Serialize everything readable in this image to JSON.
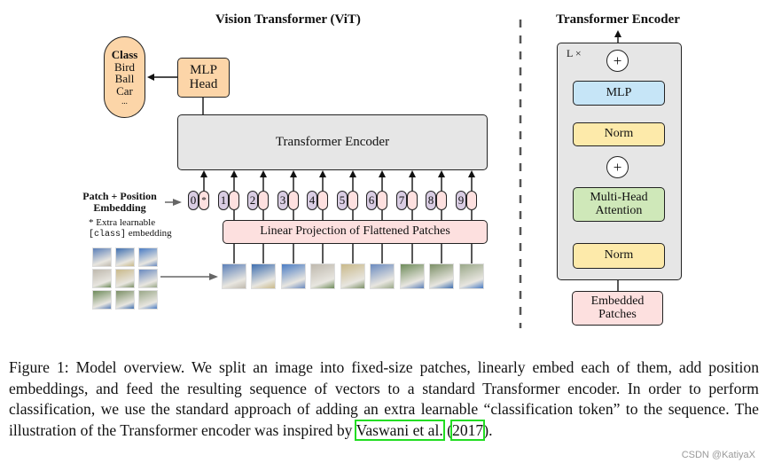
{
  "vit": {
    "title": "Vision Transformer (ViT)",
    "class_box": {
      "title": "Class",
      "items": [
        "Bird",
        "Ball",
        "Car",
        "..."
      ]
    },
    "mlp_head": [
      "MLP",
      "Head"
    ],
    "encoder_label": "Transformer Encoder",
    "embedding_label": [
      "Patch + Position",
      "Embedding"
    ],
    "extra_note_line1": "* Extra learnable",
    "extra_note_code": "[class]",
    "extra_note_rest": " embedding",
    "tokens": [
      "0",
      "1",
      "2",
      "3",
      "4",
      "5",
      "6",
      "7",
      "8",
      "9"
    ],
    "class_token_marker": "*",
    "linear_projection_label": "Linear Projection of Flattened Patches",
    "patch_count": 9
  },
  "encoder_detail": {
    "title": "Transformer Encoder",
    "repeat_label": "L ×",
    "plus_symbol": "+",
    "mlp_label": "MLP",
    "norm_top_label": "Norm",
    "mha_label": [
      "Multi-Head",
      "Attention"
    ],
    "norm_bottom_label": "Norm",
    "input_label": [
      "Embedded",
      "Patches"
    ]
  },
  "colors": {
    "encoder_bg": "#e6e6e6",
    "orange": "#fcd5a8",
    "pink": "#fde0df",
    "purple": "#d9cde3",
    "blue": "#c6e5f7",
    "yellow": "#fdeaaa",
    "green": "#cfe8b9",
    "citation_box": "#22dd22"
  },
  "caption": {
    "text": "Figure 1: Model overview. We split an image into fixed-size patches, linearly embed each of them, add position embeddings, and feed the resulting sequence of vectors to a standard Transformer encoder. In order to perform classification, we use the standard approach of adding an extra learnable “classification token” to the sequence. The illustration of the Transformer encoder was inspired by ",
    "cite_author": "Vaswani et al.",
    "cite_open": " (",
    "cite_year": "2017",
    "cite_close": ")."
  },
  "watermark": "CSDN @KatiyaX"
}
